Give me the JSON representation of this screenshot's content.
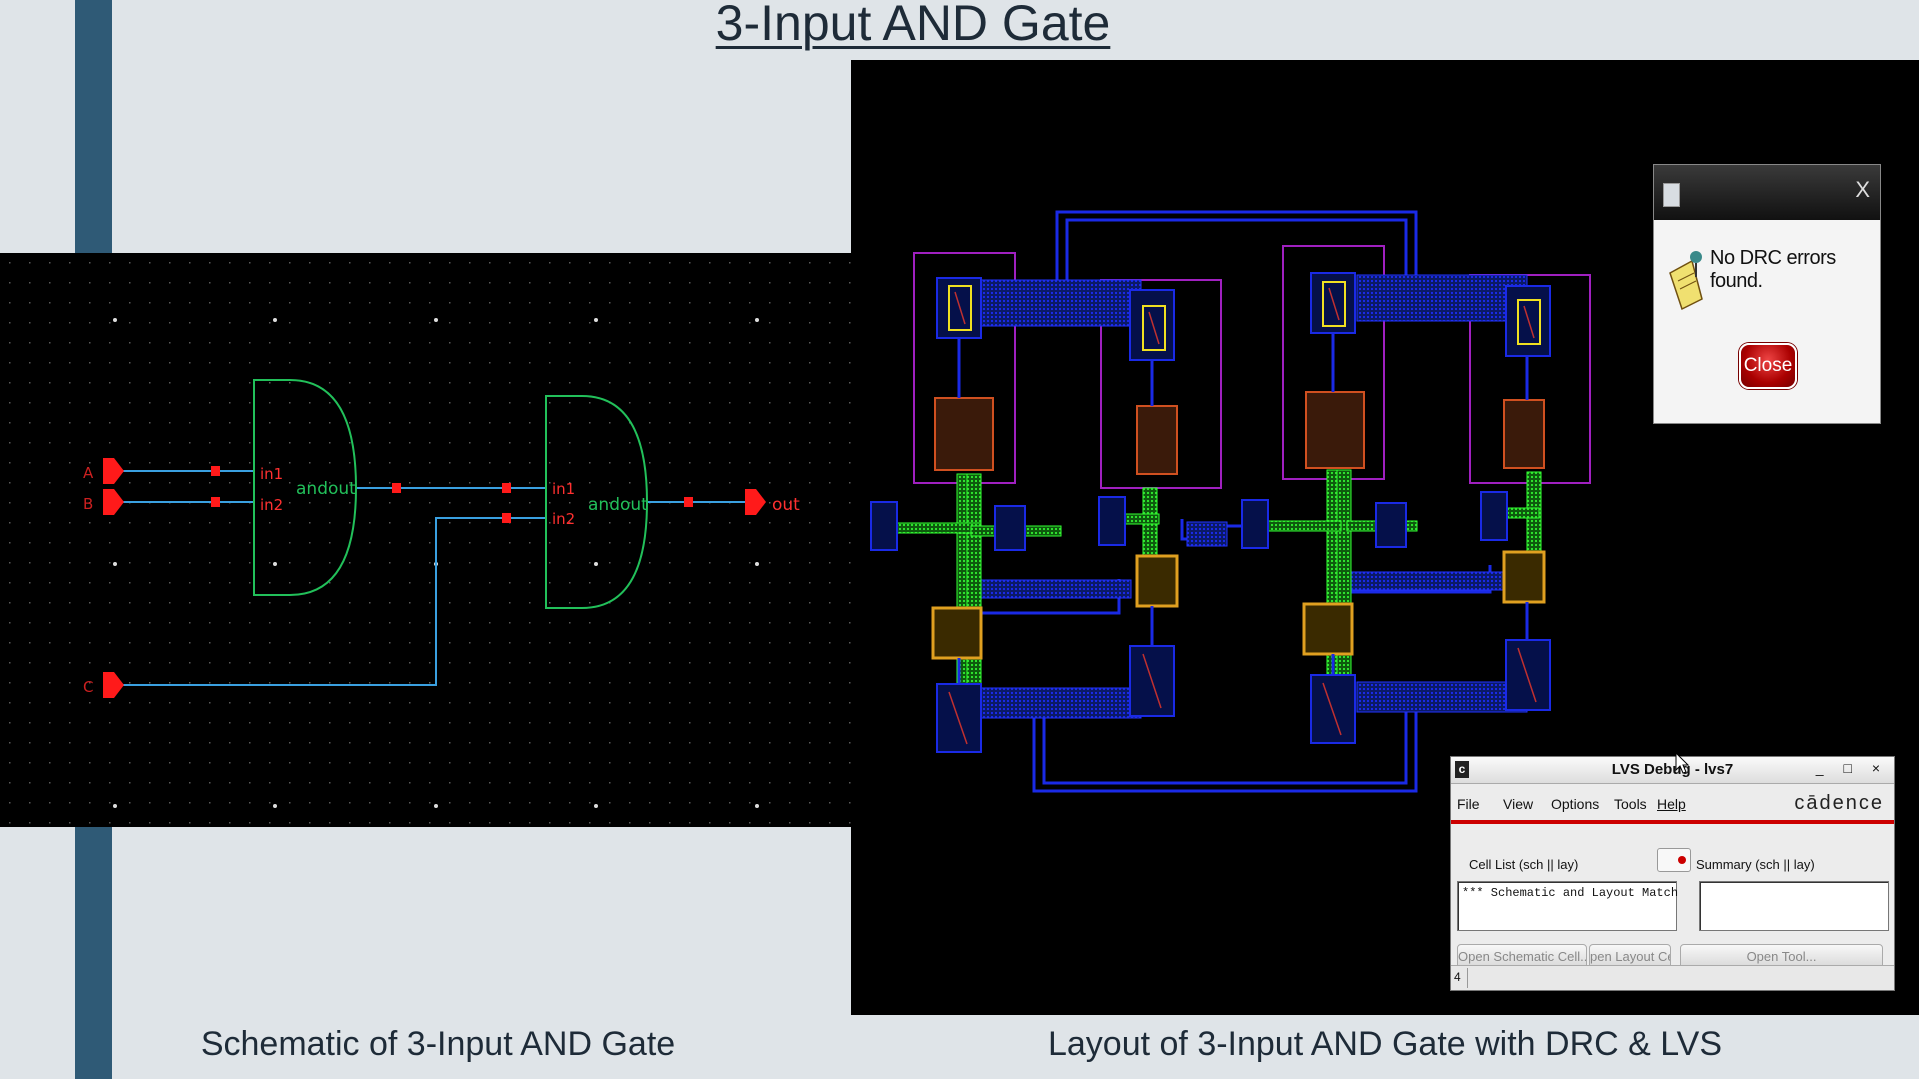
{
  "slide": {
    "title": "3-Input AND Gate",
    "caption_left": "Schematic of 3-Input AND Gate",
    "caption_right": "Layout of 3-Input AND Gate with DRC & LVS"
  },
  "schematic": {
    "inputs": [
      "A",
      "B",
      "C"
    ],
    "output": "out",
    "gate1": {
      "pin1": "in1",
      "pin2": "in2",
      "out": "andout"
    },
    "gate2": {
      "pin1": "in1",
      "pin2": "in2",
      "out": "andout"
    }
  },
  "drc_dialog": {
    "close_symbol": "X",
    "message": "No DRC errors found.",
    "button": "Close"
  },
  "lvs_window": {
    "app_icon": "c",
    "title": "LVS Debug - lvs7",
    "controls": "_ □ ×",
    "menu": [
      "File",
      "View",
      "Options",
      "Tools",
      "Help"
    ],
    "brand": "cādence",
    "cell_list_label": "Cell List (sch || lay)",
    "summary_label": "Summary (sch || lay)",
    "cell_list_row": "*** Schematic and Layout Match",
    "buttons": [
      "Open Schematic Cell...",
      "pen Layout Ce",
      "Open Tool..."
    ],
    "status_value": "4"
  },
  "colors": {
    "bar": "#2f5a76",
    "wire": "#3aa0e0",
    "gate": "#22c05a",
    "pin": "#ff1a1a",
    "metal": "#1a2ae6",
    "poly": "#22cc22"
  }
}
